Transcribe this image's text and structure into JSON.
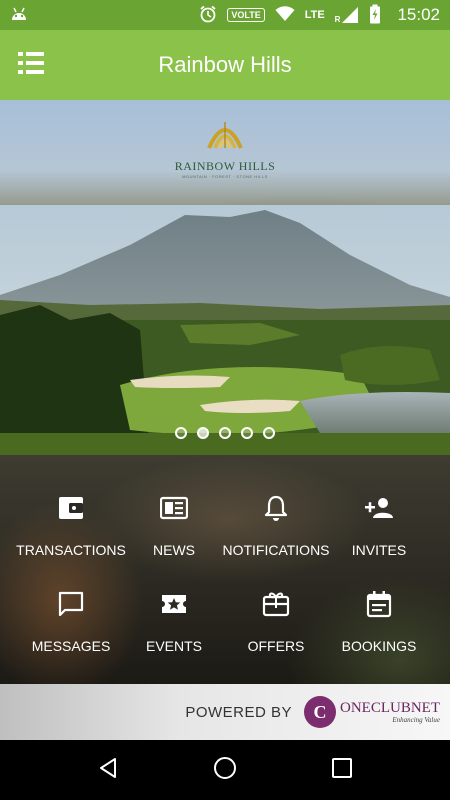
{
  "status_bar": {
    "time": "15:02",
    "volte_label": "VOLTE",
    "network_label": "LTE",
    "roaming_label": "R",
    "icons": [
      "android-icon",
      "alarm-icon",
      "wifi-icon",
      "signal-icon",
      "battery-charging-icon"
    ]
  },
  "app_bar": {
    "title": "Rainbow Hills",
    "menu_icon": "list-menu-icon"
  },
  "logo": {
    "name": "RAINBOW HILLS",
    "tagline": "MOUNTAIN · FOREST · STONE HILLS"
  },
  "carousel": {
    "dot_count": 5,
    "active_index": 1
  },
  "grid": {
    "items": [
      {
        "label": "TRANSACTIONS",
        "icon": "wallet-icon"
      },
      {
        "label": "NEWS",
        "icon": "newspaper-icon"
      },
      {
        "label": "NOTIFICATIONS",
        "icon": "bell-icon"
      },
      {
        "label": "INVITES",
        "icon": "person-add-icon"
      },
      {
        "label": "MESSAGES",
        "icon": "chat-bubble-icon"
      },
      {
        "label": "EVENTS",
        "icon": "ticket-star-icon"
      },
      {
        "label": "OFFERS",
        "icon": "gift-card-icon"
      },
      {
        "label": "BOOKINGS",
        "icon": "calendar-icon"
      }
    ]
  },
  "footer": {
    "powered_by": "POWERED BY",
    "brand_name": "ONECLUBNET",
    "brand_tagline": "Enhancing Value"
  },
  "nav_bar": {
    "buttons": [
      "back-icon",
      "home-icon",
      "recents-icon"
    ]
  },
  "colors": {
    "status_bar": "#6aa533",
    "app_bar": "#8bc34a",
    "brand_purple": "#7b2d6e"
  }
}
